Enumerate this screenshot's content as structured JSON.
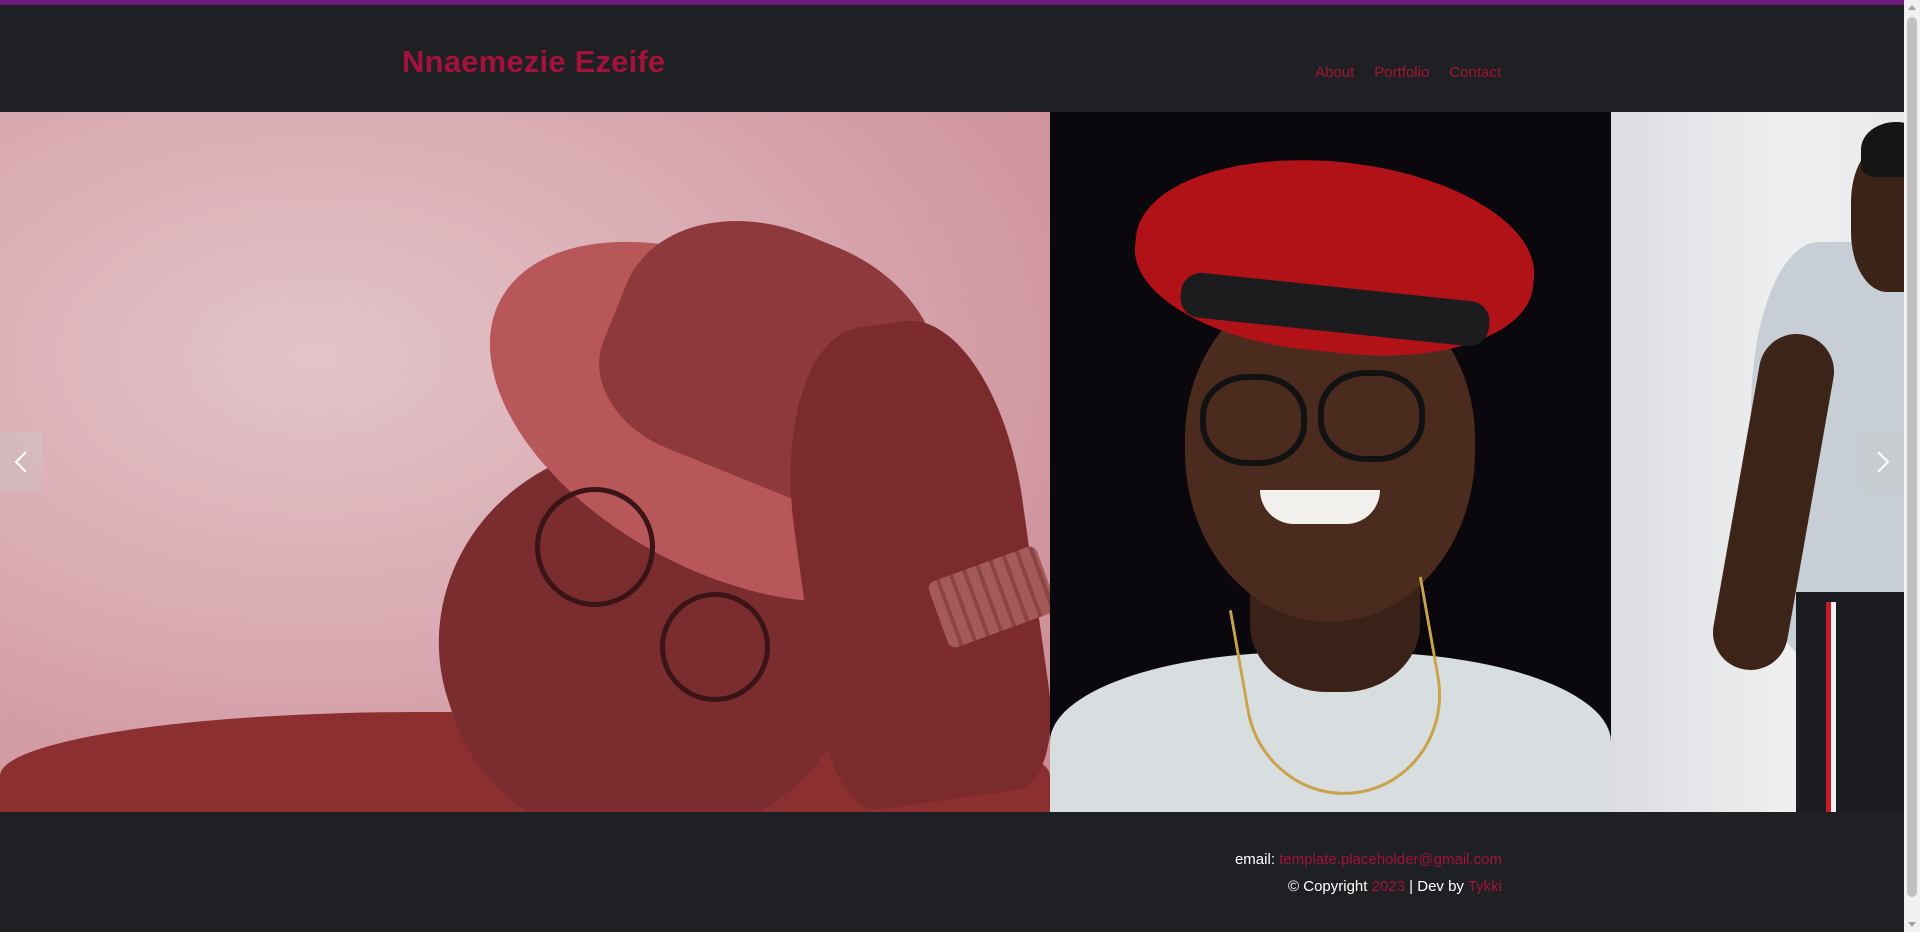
{
  "header": {
    "brand": "Nnaemezie Ezeife",
    "nav": [
      {
        "label": "About"
      },
      {
        "label": "Portfolio"
      },
      {
        "label": "Contact"
      }
    ]
  },
  "carousel": {
    "slides": [
      {
        "description_icon": "portrait-photo"
      },
      {
        "description_icon": "portrait-photo"
      },
      {
        "description_icon": "portrait-photo"
      }
    ],
    "prev_icon": "chevron-left-icon",
    "next_icon": "chevron-right-icon"
  },
  "footer": {
    "email_label": "email:",
    "email": "template.placeholder@gmail.com",
    "copyright_prefix": "© Copyright",
    "year": "2023",
    "separator": "|",
    "dev_label": "Dev by",
    "dev_name": "Tykki"
  },
  "colors": {
    "accent": "#a3123a",
    "top_bar": "#6b1a7a",
    "background": "#1f2024"
  }
}
